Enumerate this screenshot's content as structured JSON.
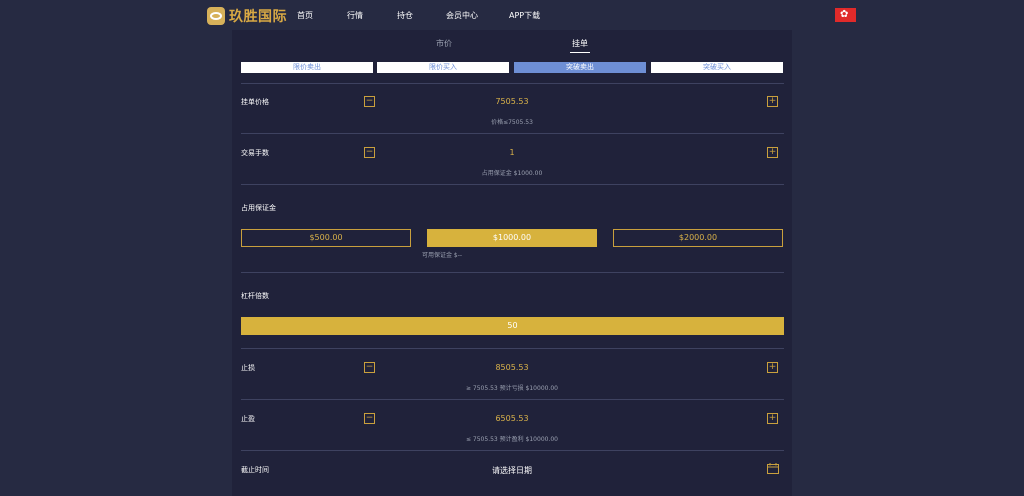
{
  "header": {
    "brand": "玖胜国际",
    "nav": [
      "首页",
      "行情",
      "持仓",
      "会员中心",
      "APP下载"
    ]
  },
  "tabs": {
    "market": "市价",
    "limit": "挂单"
  },
  "order_types": [
    "限价卖出",
    "限价买入",
    "突破卖出",
    "突破买入"
  ],
  "order_price": {
    "label": "挂单价格",
    "value": "7505.53",
    "hint": "价格≤7505.53"
  },
  "quantity": {
    "label": "交易手数",
    "value": "1",
    "hint": "占用保证金 $1000.00"
  },
  "margin": {
    "label": "占用保证金",
    "options": [
      "$500.00",
      "$1000.00",
      "$2000.00"
    ],
    "available": "可用保证金 $--"
  },
  "leverage": {
    "label": "杠杆倍数",
    "value": "50"
  },
  "stop_loss": {
    "label": "止损",
    "value": "8505.53",
    "hint": "≥ 7505.53 预计亏损 $10000.00"
  },
  "take_profit": {
    "label": "止盈",
    "value": "6505.53",
    "hint": "≤ 7505.53 预计盈利 $10000.00"
  },
  "expiry": {
    "label": "截止时间",
    "placeholder": "请选择日期"
  },
  "colors": {
    "accent": "#d7b23d",
    "active_tab": "#6e8fd5",
    "background": "#262a42",
    "panel": "#20223a"
  }
}
